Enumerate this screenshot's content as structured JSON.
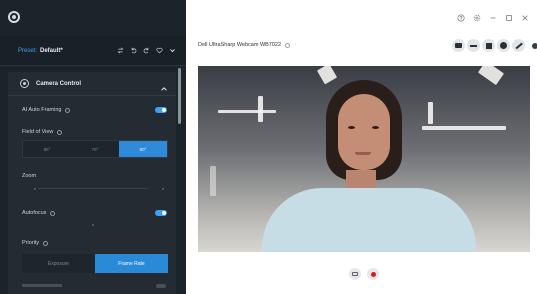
{
  "app": {
    "logo": "webcam-app-logo"
  },
  "preset": {
    "label": "Preset:",
    "value": "Default*",
    "icons": [
      "swap-icon",
      "undo-icon",
      "redo-icon",
      "favorite-icon",
      "chevron-down-icon"
    ]
  },
  "camera_control": {
    "title": "Camera Control",
    "ai_auto_framing": {
      "label": "AI Auto Framing",
      "on": true
    },
    "field_of_view": {
      "label": "Field of View",
      "options": [
        "65°",
        "78°",
        "90°"
      ],
      "selected": "90°"
    },
    "zoom": {
      "label": "Zoom"
    },
    "autofocus": {
      "label": "Autofocus",
      "on": true
    },
    "priority": {
      "label": "Priority",
      "options": [
        "Exposure",
        "Frame Rate"
      ],
      "selected": "Frame Rate"
    }
  },
  "window": {
    "controls": [
      "help-icon",
      "settings-icon",
      "minimize-icon",
      "maximize-icon",
      "close-icon"
    ]
  },
  "device": {
    "name": "Dell UltraSharp Webcam WB7022"
  },
  "toolbar": {
    "tools": [
      "camera-icon",
      "microphone-icon",
      "video-icon",
      "effects-icon",
      "pen-icon"
    ],
    "extra": "more-icon"
  },
  "preview": {
    "recording_controls": [
      "open-folder-icon",
      "record-icon"
    ]
  },
  "colors": {
    "accent": "#2f8bd9",
    "sidebar_bg": "#1d232b",
    "record": "#e0162b"
  }
}
